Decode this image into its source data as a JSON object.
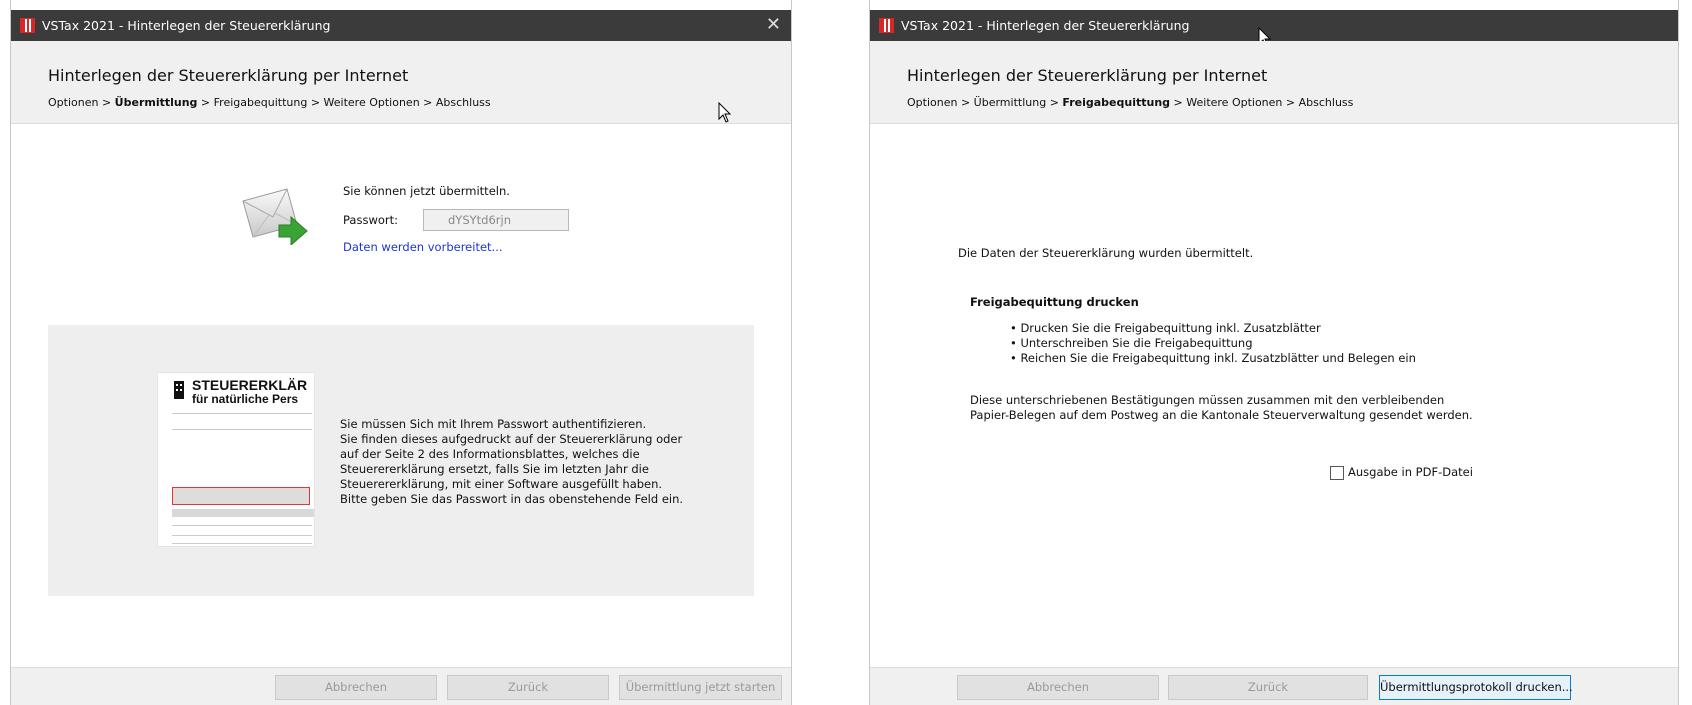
{
  "left_window": {
    "title": "VSTax 2021 - Hinterlegen der Steuererklärung",
    "close_glyph": "✕",
    "heading": "Hinterlegen der Steuererklärung per Internet",
    "breadcrumb": {
      "step1": "Optionen",
      "sep": ">",
      "step2": "Übermittlung",
      "step3": "Freigabequittung",
      "step4": "Weitere Optionen",
      "step5": "Abschluss"
    },
    "ready_text": "Sie können jetzt übermitteln.",
    "password_label": "Passwort:",
    "password_value": "dYSYtd6rjn",
    "status_link": "Daten werden vorbereitet...",
    "thumbnail": {
      "title_line1": "STEUERERKLÄR",
      "title_line2": "für natürliche Pers"
    },
    "info_lines": [
      "Sie müssen Sich mit Ihrem Passwort authentifizieren.",
      "Sie finden dieses aufgedruckt auf der Steuererklärung oder",
      "auf der Seite 2 des Informationsblattes, welches die",
      "Steuerererklärung ersetzt, falls Sie im letzten Jahr die",
      "Steuerererklärung, mit einer Software ausgefüllt haben.",
      "Bitte geben Sie das Passwort in das obenstehende Feld ein."
    ],
    "buttons": {
      "cancel": "Abbrechen",
      "back": "Zurück",
      "start": "Übermittlung jetzt starten"
    }
  },
  "right_window": {
    "title": "VSTax 2021 - Hinterlegen der Steuererklärung",
    "heading": "Hinterlegen der Steuererklärung per Internet",
    "breadcrumb": {
      "step1": "Optionen",
      "sep": ">",
      "step2": "Übermittlung",
      "step3": "Freigabequittung",
      "step4": "Weitere Optionen",
      "step5": "Abschluss"
    },
    "sent_text": "Die Daten der Steuererklärung wurden übermittelt.",
    "section_title": "Freigabequittung drucken",
    "bullets": [
      "• Drucken Sie die Freigabequittung inkl. Zusatzblätter",
      "• Unterschreiben Sie die Freigabequittung",
      "• Reichen Sie die Freigabequittung inkl. Zusatzblätter und Belegen ein"
    ],
    "note_lines": [
      "Diese unterschriebenen Bestätigungen müssen zusammen mit den verbleibenden",
      "Papier-Belegen auf dem Postweg an die Kantonale Steuerverwaltung gesendet werden."
    ],
    "pdf_checkbox_label": "Ausgabe in PDF-Datei",
    "pdf_checked": false,
    "buttons": {
      "cancel": "Abbrechen",
      "back": "Zurück",
      "print_log": "Übermittlungsprotokoll drucken..."
    }
  },
  "colors": {
    "titlebar": "#3b3b3b",
    "header_bg": "#f0f0f0",
    "link": "#1a36d4",
    "app_icon": "#d62828",
    "envelope_arrow": "#3aa335"
  },
  "icons": [
    "app-icon",
    "close-icon",
    "envelope-send-icon",
    "mouse-cursor-icon"
  ]
}
